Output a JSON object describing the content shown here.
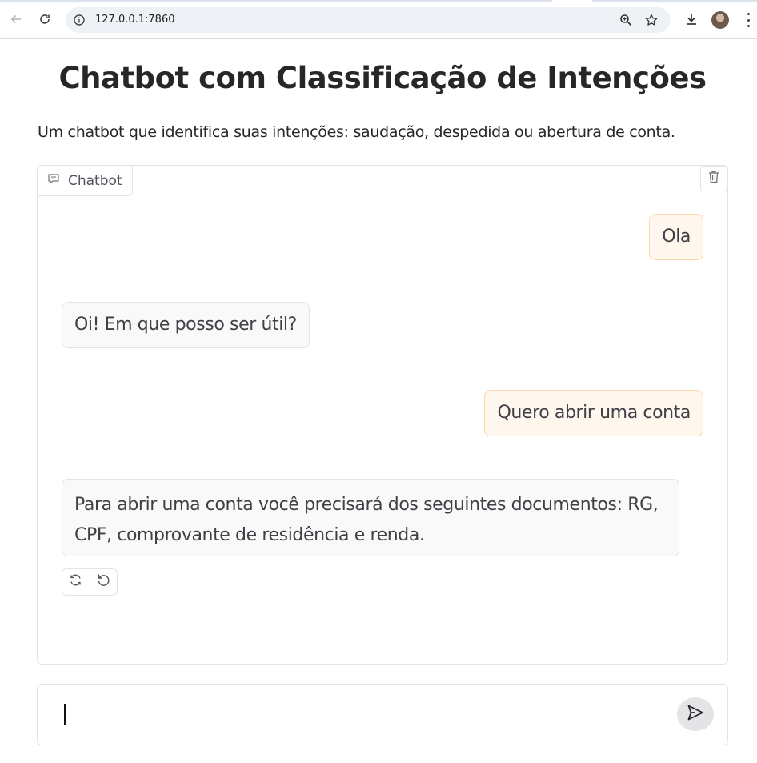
{
  "browser": {
    "url": "127.0.0.1:7860",
    "icons": [
      "back-arrow-icon",
      "reload-icon",
      "site-info-icon",
      "zoom-icon",
      "bookmark-star-icon",
      "download-icon",
      "profile-avatar",
      "more-menu-icon"
    ]
  },
  "page": {
    "title": "Chatbot com Classificação de Intenções",
    "description": "Um chatbot que identifica suas intenções: saudação, despedida ou abertura de conta."
  },
  "chatbot": {
    "label": "Chatbot",
    "messages": [
      {
        "role": "user",
        "text": "Ola"
      },
      {
        "role": "bot",
        "text": "Oi! Em que posso ser útil?"
      },
      {
        "role": "user",
        "text": "Quero abrir uma conta"
      },
      {
        "role": "bot",
        "text": "Para abrir uma conta você precisará dos seguintes documentos: RG, CPF, comprovante de residência e renda."
      }
    ]
  },
  "input": {
    "value": "",
    "placeholder": ""
  },
  "colors": {
    "user_bubble_bg": "#fff7ed",
    "user_bubble_border": "#fed7aa",
    "bot_bubble_bg": "#f9f9f9",
    "panel_border": "#e4e4e7",
    "send_button_bg": "#e4e4e7"
  }
}
